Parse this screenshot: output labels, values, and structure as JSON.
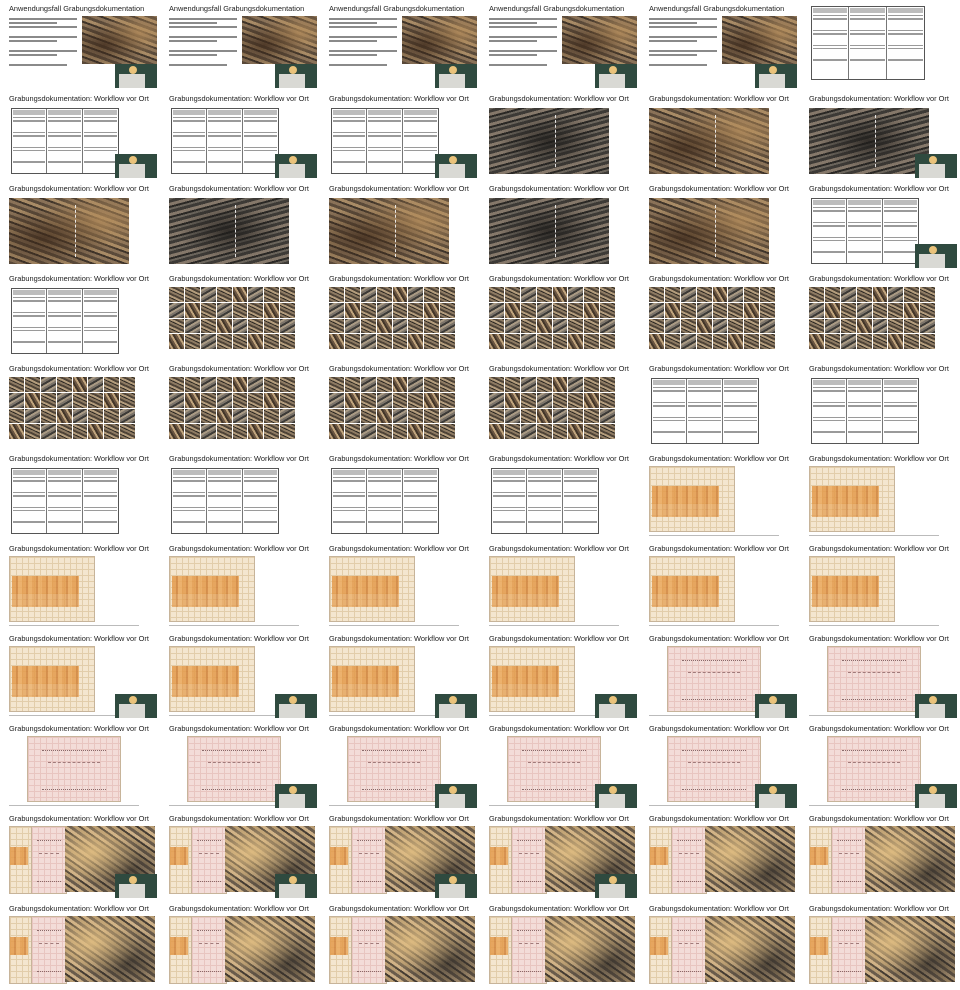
{
  "titles": {
    "anwendungsfall": "Anwendungsfall Grabungsdokumentation",
    "workflow": "Grabungsdokumentation: Workflow vor Ort"
  },
  "rows": [
    [
      "intro",
      "intro",
      "intro",
      "intro",
      "intro",
      "table"
    ],
    [
      "table",
      "table",
      "table",
      "photo",
      "photo",
      "photo"
    ],
    [
      "photo",
      "photo",
      "photo",
      "photo",
      "photo",
      "table"
    ],
    [
      "table",
      "thumbs",
      "thumbs",
      "thumbs",
      "thumbs",
      "thumbs"
    ],
    [
      "thumbs",
      "thumbs",
      "thumbs",
      "thumbs",
      "table",
      "table"
    ],
    [
      "table",
      "table",
      "table",
      "table",
      "drawing",
      "drawing"
    ],
    [
      "drawing",
      "drawing",
      "drawing",
      "drawing",
      "drawing",
      "drawing"
    ],
    [
      "drawing",
      "drawing",
      "drawing",
      "drawing",
      "drawing-pink",
      "drawing-pink"
    ],
    [
      "drawing-pink",
      "drawing-pink",
      "drawing-pink",
      "drawing-pink",
      "drawing-pink",
      "drawing-pink"
    ],
    [
      "drawing-photo",
      "drawing-photo",
      "drawing-photo",
      "drawing-photo",
      "drawing-photo",
      "drawing-photo"
    ],
    [
      "drawing-photo",
      "drawing-photo",
      "drawing-photo",
      "drawing-photo",
      "drawing-photo",
      "drawing-photo"
    ]
  ],
  "presenter_rows": [
    0,
    1,
    2,
    6,
    7,
    8,
    9
  ],
  "no_presenter_cells": [
    "0-5",
    "1-3",
    "1-4",
    "2-0",
    "2-1",
    "2-2",
    "2-3",
    "2-4",
    "2-5",
    "6-0",
    "6-1",
    "6-2",
    "6-3",
    "6-4",
    "6-5",
    "9-4",
    "9-5",
    "8-0"
  ],
  "colors": {
    "presenter_background": "#2f4a3f",
    "drawing_paper": "#f4e6cf",
    "drawing_paper_pink": "#f3dcd8",
    "stratum_orange": "#e39a4b"
  }
}
